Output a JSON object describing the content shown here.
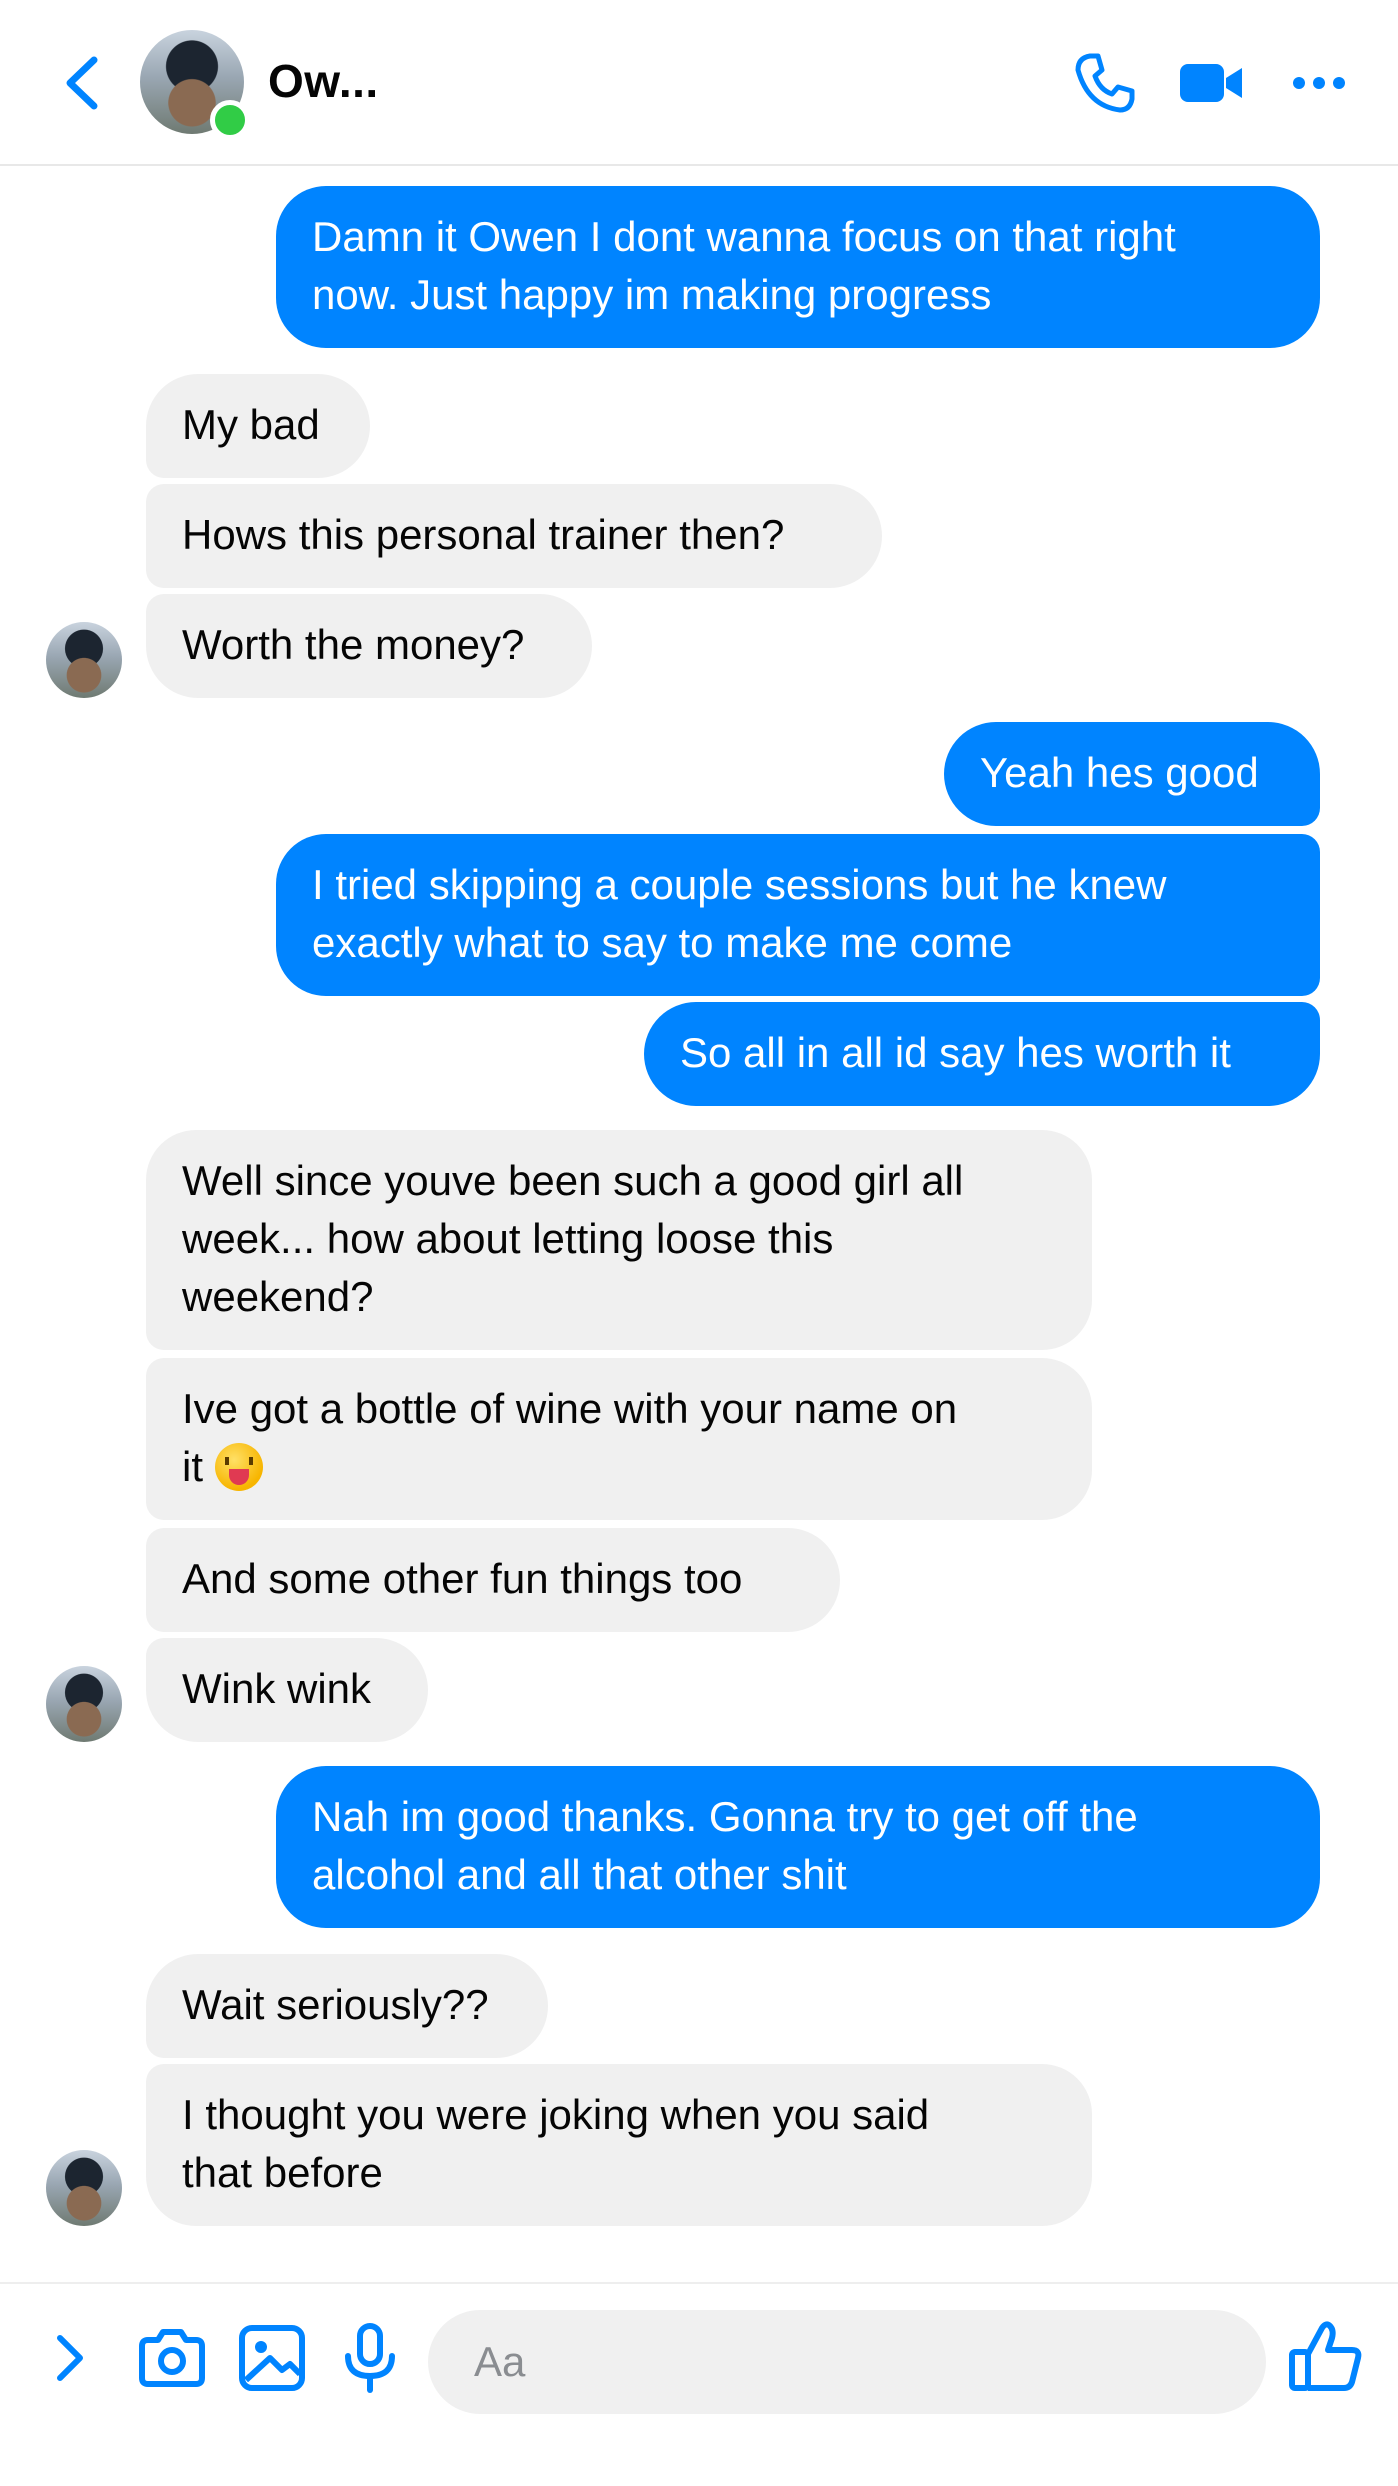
{
  "header": {
    "contact_name": "Ow...",
    "online": true
  },
  "colors": {
    "accent": "#0084ff",
    "incoming_bubble": "#f0f0f0",
    "online": "#31cc46"
  },
  "messages": [
    {
      "from": "me",
      "text": "Damn it Owen I dont wanna focus on that right\nnow. Just happy im making progress"
    },
    {
      "from": "them",
      "text": "My bad"
    },
    {
      "from": "them",
      "text": "Hows this personal trainer then?"
    },
    {
      "from": "them",
      "text": "Worth the money?"
    },
    {
      "from": "me",
      "text": "Yeah hes good"
    },
    {
      "from": "me",
      "text": "I tried skipping a couple sessions but he knew\nexactly what to say to make me come"
    },
    {
      "from": "me",
      "text": "So all in all id say hes worth it"
    },
    {
      "from": "them",
      "text": "Well since youve been such a good girl all\nweek... how about letting loose this\nweekend?"
    },
    {
      "from": "them",
      "text": "Ive got a bottle of wine with your name on\nit ",
      "emoji": "squinting-face-with-tongue"
    },
    {
      "from": "them",
      "text": "And some other fun things too"
    },
    {
      "from": "them",
      "text": "Wink wink"
    },
    {
      "from": "me",
      "text": "Nah im good thanks. Gonna try to get off the\nalcohol and all that other shit"
    },
    {
      "from": "them",
      "text": "Wait seriously??"
    },
    {
      "from": "them",
      "text": "I thought you were joking when you said\nthat before"
    }
  ],
  "composer": {
    "placeholder": "Aa",
    "icons": [
      "chevron-right-icon",
      "camera-icon",
      "image-icon",
      "microphone-icon",
      "thumbs-up-icon"
    ]
  }
}
